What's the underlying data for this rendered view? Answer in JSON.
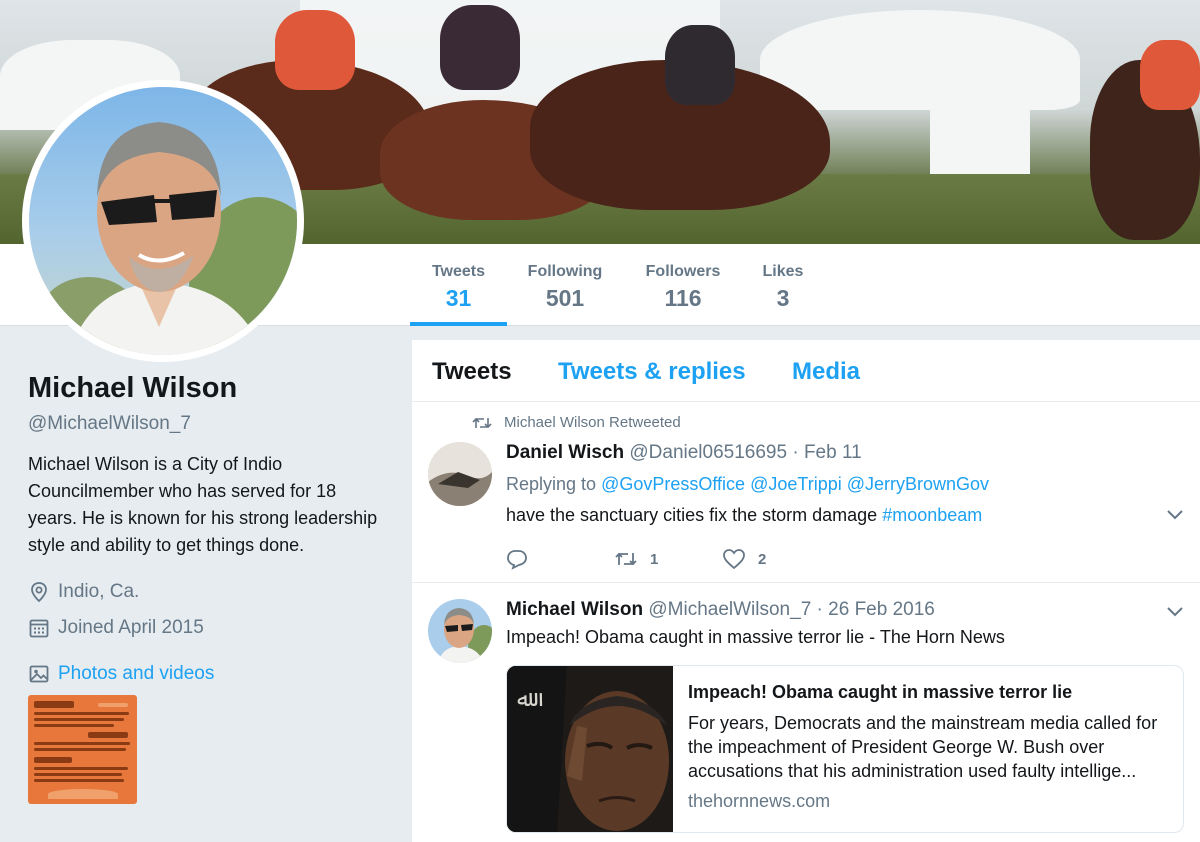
{
  "profile": {
    "name": "Michael Wilson",
    "handle": "@MichaelWilson_7",
    "bio": "Michael Wilson is a City of Indio Councilmember who has served for 18 years. He is known for his strong leadership style and ability to get things done.",
    "location": "Indio, Ca.",
    "joined": "Joined April 2015",
    "photos_label": "Photos and videos"
  },
  "stats": [
    {
      "label": "Tweets",
      "value": "31",
      "active": true
    },
    {
      "label": "Following",
      "value": "501",
      "active": false
    },
    {
      "label": "Followers",
      "value": "116",
      "active": false
    },
    {
      "label": "Likes",
      "value": "3",
      "active": false
    }
  ],
  "tabs": [
    {
      "label": "Tweets",
      "active": true
    },
    {
      "label": "Tweets & replies",
      "active": false
    },
    {
      "label": "Media",
      "active": false
    }
  ],
  "tweets": [
    {
      "retweet_label": "Michael Wilson Retweeted",
      "display_name": "Daniel Wisch",
      "username": "@Daniel06516695",
      "date": "· Feb 11",
      "replying_prefix": "Replying to",
      "replying_to": [
        "@GovPressOffice",
        "@JoeTrippi",
        "@JerryBrownGov"
      ],
      "text": "have the sanctuary cities fix the storm damage",
      "hashtag": "#moonbeam",
      "retweets": "1",
      "likes": "2"
    },
    {
      "display_name": "Michael Wilson",
      "username": "@MichaelWilson_7",
      "date": "· 26 Feb 2016",
      "text": "Impeach! Obama caught in massive terror lie - The Horn News",
      "card": {
        "title": "Impeach! Obama caught in massive terror lie",
        "description": "For years, Democrats and the mainstream media called for the impeachment of President George W. Bush over accusations that his administration used faulty intellige...",
        "domain": "thehornnews.com"
      }
    }
  ],
  "colors": {
    "accent": "#1da1f2",
    "secondary_text": "#657786",
    "background": "#e6ecf0"
  },
  "icons": [
    "location-icon",
    "calendar-icon",
    "image-icon",
    "retweet-icon",
    "reply-icon",
    "heart-icon",
    "chevron-down-icon"
  ]
}
